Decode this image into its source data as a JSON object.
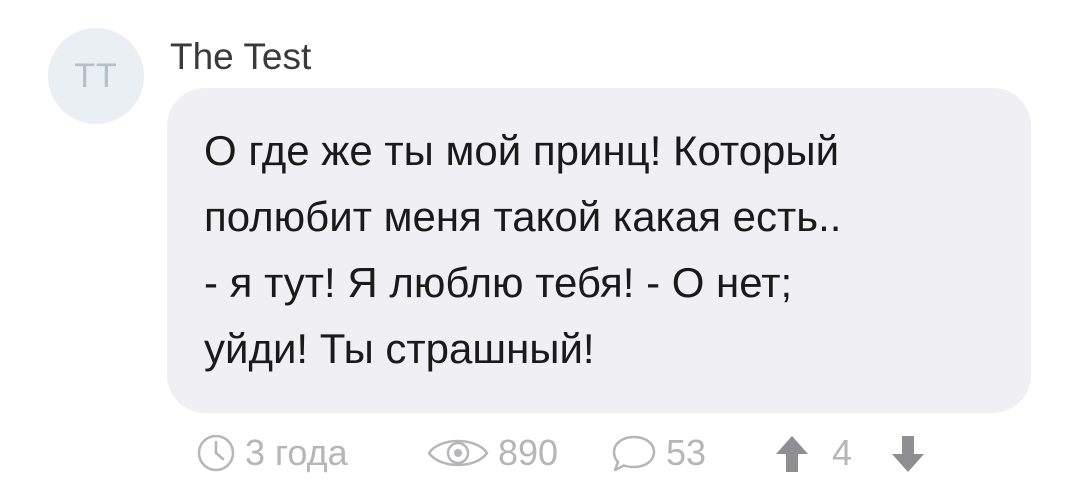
{
  "comment": {
    "avatar_initials": "TT",
    "author": "The Test",
    "text": "О где же ты мой принц! Который\nполюбит меня такой какая есть..\n- я тут! Я люблю тебя! - О нет;\nуйди! Ты страшный!",
    "meta": {
      "age": "3 года",
      "views": "890",
      "replies": "53",
      "rating": "4"
    },
    "icons": [
      "clock-icon",
      "eye-icon",
      "comment-bubble-icon",
      "upvote-arrow-icon",
      "downvote-arrow-icon"
    ],
    "colors": {
      "avatar_bg": "#e9eff2",
      "bubble_bg": "#efeff4",
      "meta_text": "#b5b5ba",
      "vote_arrow": "#8e8e93"
    }
  }
}
